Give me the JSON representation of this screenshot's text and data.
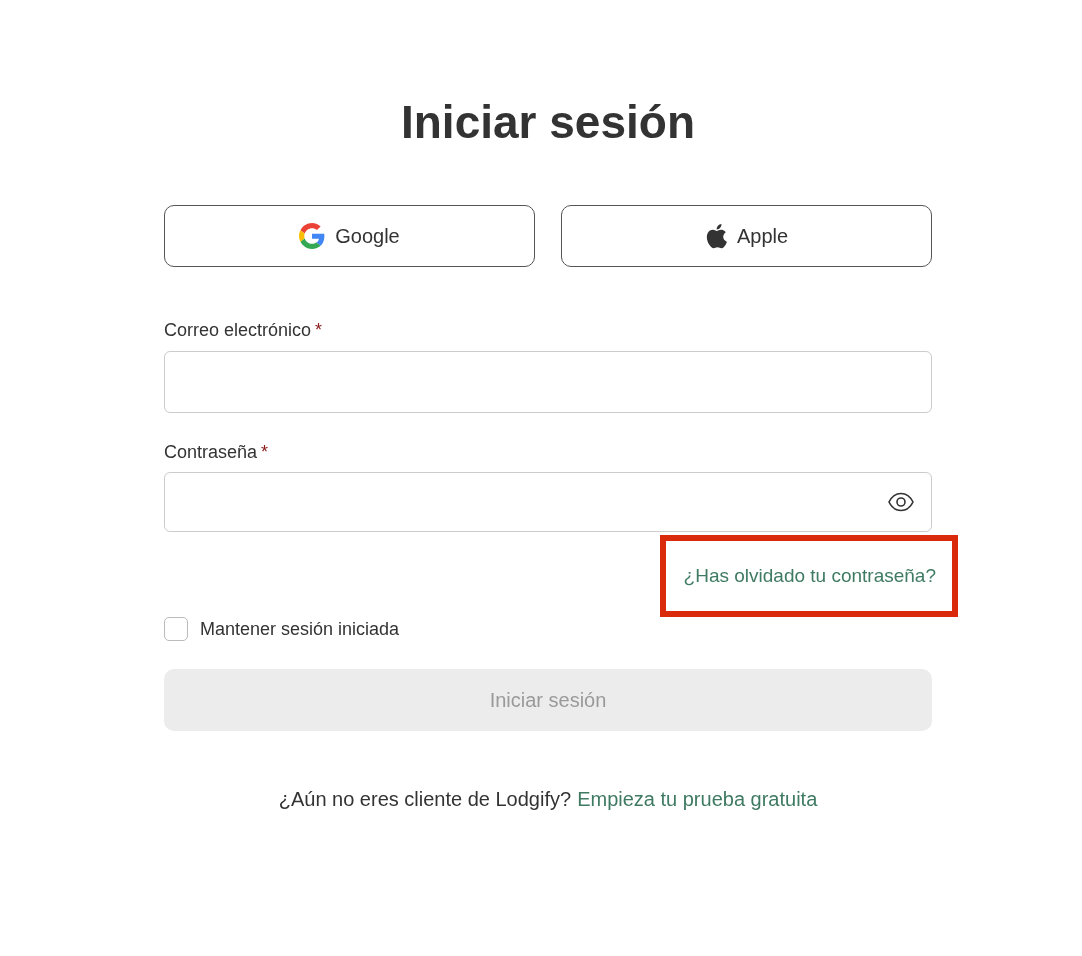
{
  "title": "Iniciar sesión",
  "social_buttons": [
    {
      "label": "Google",
      "kind": "google"
    },
    {
      "label": "Apple",
      "kind": "apple"
    }
  ],
  "fields": [
    {
      "label": "Correo electrónico",
      "required_mark": "*",
      "kind": "email"
    },
    {
      "label": "Contraseña",
      "required_mark": "*",
      "kind": "password"
    }
  ],
  "forgot_password": {
    "label": "¿Has olvidado tu contraseña?",
    "highlighted": true
  },
  "remember_me": {
    "label": "Mantener sesión iniciada",
    "checked": false
  },
  "submit": {
    "label": "Iniciar sesión",
    "disabled": true
  },
  "signup": {
    "text": "¿Aún no eres cliente de Lodgify?",
    "link": "Empieza tu prueba gratuita"
  }
}
